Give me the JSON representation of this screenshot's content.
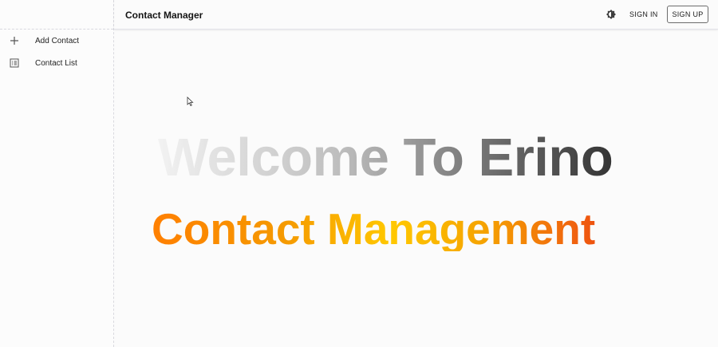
{
  "header": {
    "title": "Contact Manager",
    "signin_label": "SIGN IN",
    "signup_label": "SIGN UP",
    "theme_icon": "brightness-icon"
  },
  "sidebar": {
    "items": [
      {
        "label": "Add Contact",
        "icon": "plus-icon"
      },
      {
        "label": "Contact List",
        "icon": "list-icon"
      }
    ]
  },
  "main": {
    "welcome": "Welcome To Erino",
    "subtitle": "Contact Management"
  },
  "colors": {
    "welcome_gradient": [
      "#f2f2f2",
      "#bdbdbd",
      "#6b6b6b",
      "#111111"
    ],
    "subtitle_gradient": [
      "#ff7f00",
      "#ffc800",
      "#f06010",
      "#e00000"
    ]
  }
}
